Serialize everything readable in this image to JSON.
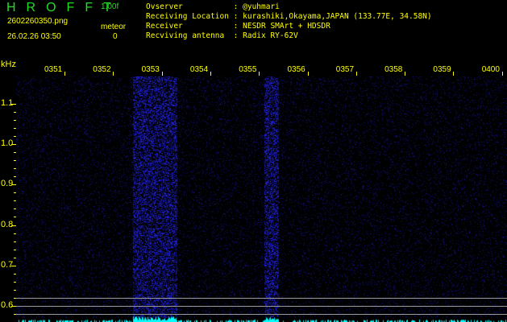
{
  "header": {
    "title": "HROFFT",
    "version": "1.00f",
    "filename": "2602260350.png",
    "datetime": "26.02.26 03:50",
    "meteor_label": "meteor",
    "meteor_count": "0"
  },
  "info": [
    {
      "label": "Ovserver          ",
      "value": "@yuhmari"
    },
    {
      "label": "Receiving Location",
      "value": "kurashiki,Okayama,JAPAN (133.77E, 34.58N)"
    },
    {
      "label": "Receiver          ",
      "value": "NESDR SMArt + HDSDR"
    },
    {
      "label": "Recviving antenna ",
      "value": "Radix RY-62V"
    }
  ],
  "axis": {
    "unit": "kHz",
    "time_labels": [
      "0351",
      "0352",
      "0353",
      "0354",
      "0355",
      "0356",
      "0357",
      "0358",
      "0359",
      "0400"
    ],
    "freq_labels": [
      "1.1",
      "1.0",
      "0.9",
      "0.8",
      "0.7",
      "0.6"
    ]
  },
  "colors": {
    "text": "#ffff00",
    "title": "#22dd22",
    "signal": "#2a2aff",
    "spectrum": "#00ffff"
  }
}
